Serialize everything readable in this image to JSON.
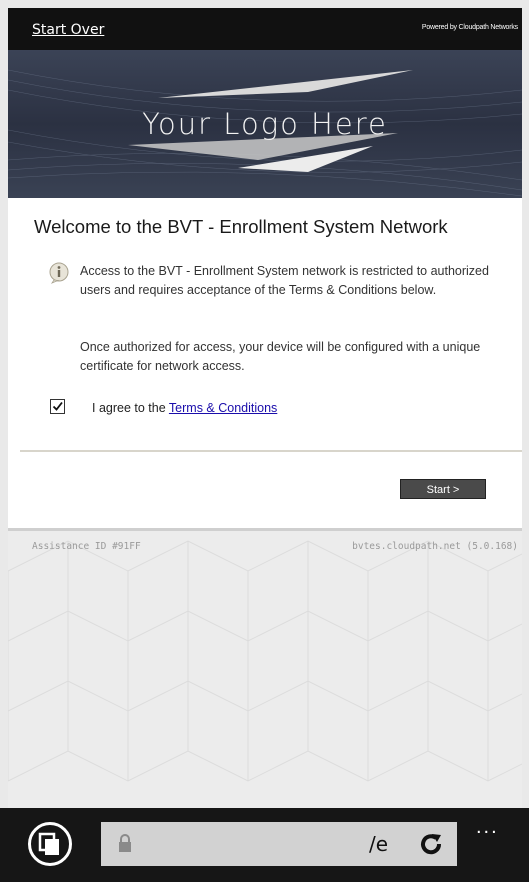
{
  "topbar": {
    "start_over": "Start Over",
    "powered_by": "Powered by Cloudpath Networks"
  },
  "banner": {
    "logo_text": "Your Logo Here"
  },
  "main": {
    "title": "Welcome to the BVT - Enrollment System Network",
    "paragraph1": "Access to the BVT - Enrollment System network is restricted to authorized users and requires acceptance of the Terms & Conditions below.",
    "paragraph2": "Once authorized for access, your device will be configured with a unique certificate for network access.",
    "agree_prefix": "I agree to the ",
    "terms_link": "Terms & Conditions",
    "agree_checked": true,
    "start_button": "Start >"
  },
  "footer": {
    "assistance_id": "Assistance ID #91FF",
    "server": "bvtes.cloudpath.net (5.0.168)"
  },
  "browser": {
    "url_fragment": "/e",
    "more": "..."
  },
  "icons": {
    "info": "info-icon",
    "checkbox": "checkmark-icon",
    "tabs": "tabs-icon",
    "lock": "lock-icon",
    "refresh": "refresh-icon"
  }
}
